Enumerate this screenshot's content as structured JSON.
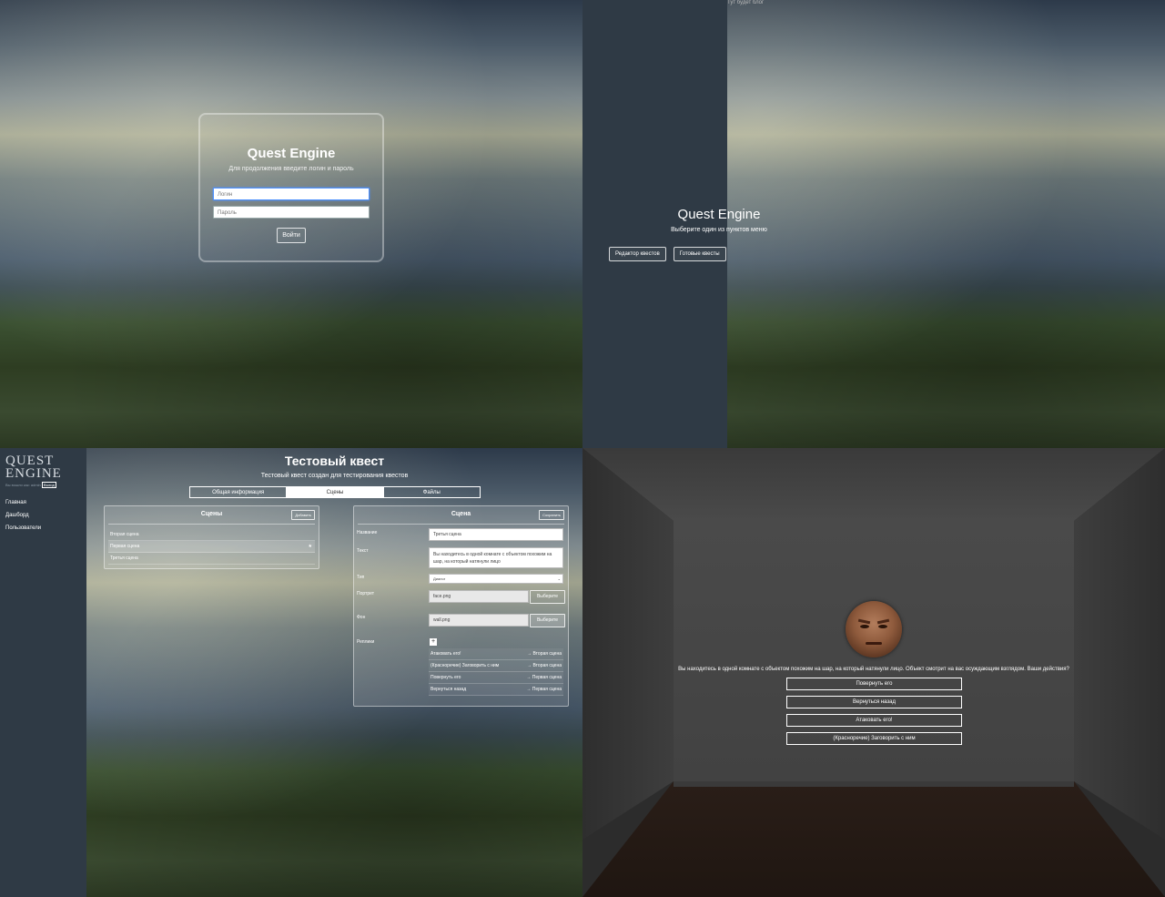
{
  "login": {
    "title": "Quest Engine",
    "subtitle": "Для продолжения введите логин и пароль",
    "login_placeholder": "Логин",
    "password_placeholder": "Пароль",
    "submit_label": "Войти"
  },
  "menu": {
    "note": "Тут будет блог",
    "title": "Quest Engine",
    "subtitle": "Выберите один из пунктов меню",
    "editor_button": "Редактор квестов",
    "ready_button": "Готовые квесты"
  },
  "editor": {
    "logo_line1": "QUEST",
    "logo_line2": "ENGINE",
    "user_prefix": "Вы вошли как: admin",
    "logout_label": "Выход",
    "nav": [
      "Главная",
      "Дашборд",
      "Пользователи"
    ],
    "quest_title": "Тестовый квест",
    "quest_subtitle": "Тестовый квест создан для тестирования квестов",
    "tabs": [
      "Общая информация",
      "Сцены",
      "Файлы"
    ],
    "scenes_panel": {
      "title": "Сцены",
      "add_label": "Добавить",
      "items": [
        "Вторая сцена",
        "Первая сцена",
        "Третья сцена"
      ],
      "star": "★"
    },
    "scene_panel": {
      "title": "Сцена",
      "save_label": "Сохранить",
      "name_label": "Название",
      "name_value": "Третья сцена",
      "text_label": "Текст",
      "text_value": "Вы находитесь в одной комнате с объектом похожим на шар, на который натянули лицо",
      "type_label": "Тип",
      "type_value": "Диалог",
      "portrait_label": "Портрет",
      "portrait_value": "face.png",
      "choose_label": "Выберите",
      "bg_label": "Фон",
      "bg_value": "wall.png",
      "replies_label": "Реплики",
      "add_reply": "+",
      "replies": [
        {
          "text": "Атаковать его!",
          "target": "→ Вторая сцена"
        },
        {
          "text": "(Красноречие) Заговорить с ним",
          "target": "→ Вторая сцена"
        },
        {
          "text": "Повернуть его",
          "target": "→ Первая сцена"
        },
        {
          "text": "Вернуться назад",
          "target": "→ Первая сцена"
        }
      ]
    }
  },
  "game": {
    "text": "Вы находитесь в одной комнате с объектом похожим на шар, на который натянули лицо. Объект смотрит на вас осуждающим взглядом. Ваши действия?",
    "choices": [
      "Повернуть его",
      "Вернуться назад",
      "Атаковать его!",
      "(Красноречие) Заговорить с ним"
    ]
  }
}
